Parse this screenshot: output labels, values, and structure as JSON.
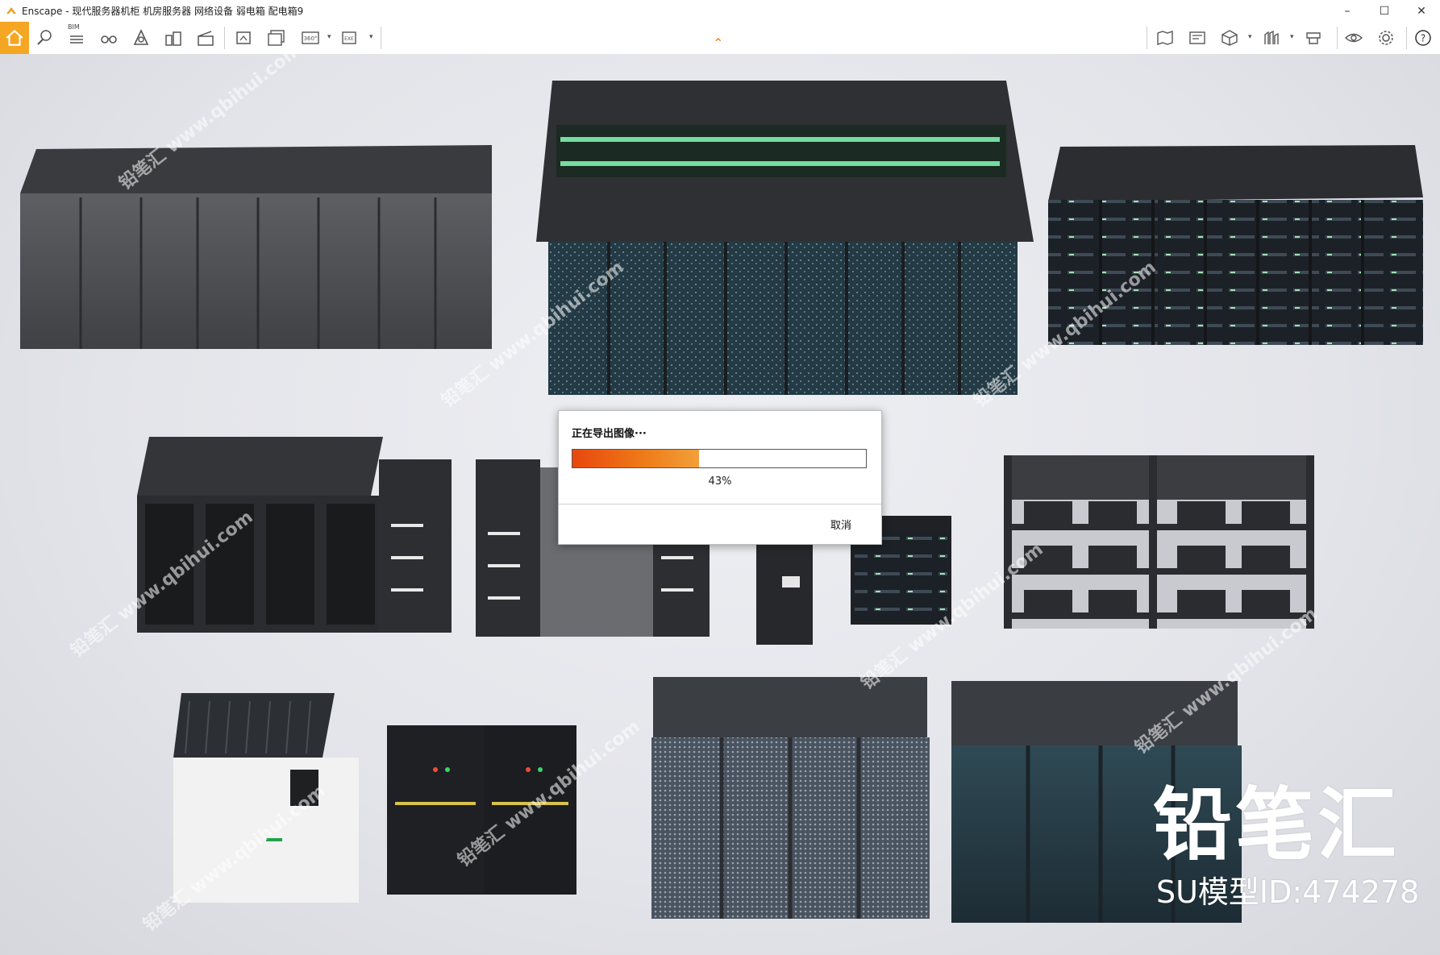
{
  "window": {
    "title": "Enscape - 现代服务器机柜 机房服务器 网络设备 弱电箱 配电箱9",
    "controls": [
      "minimize-icon",
      "maximize-icon",
      "close-icon"
    ]
  },
  "toolbar": {
    "bim_label": "BIM",
    "left_icons": [
      "home-icon",
      "walk-mode-icon",
      "bim-icon",
      "binoculars-icon",
      "light-icon",
      "buildings-icon",
      "clapper-icon",
      "screenshot-icon",
      "batch-render-icon",
      "panorama-360-icon",
      "exe-export-icon"
    ],
    "panorama_label": "360°",
    "exe_label": "EXE",
    "right_icons": [
      "map-icon",
      "view-management-icon",
      "cube-icon",
      "asset-library-icon",
      "material-icon",
      "visual-settings-icon",
      "gear-icon",
      "help-icon"
    ],
    "accent_color": "#f5a623"
  },
  "dialog": {
    "title": "正在导出图像···",
    "progress_percent": 43,
    "progress_text": "43%",
    "cancel_label": "取消"
  },
  "watermark": {
    "brand": "铅笔汇",
    "model_id": "SU模型ID:474278",
    "repeat_text": "铅笔汇 www.qbihui.com"
  }
}
